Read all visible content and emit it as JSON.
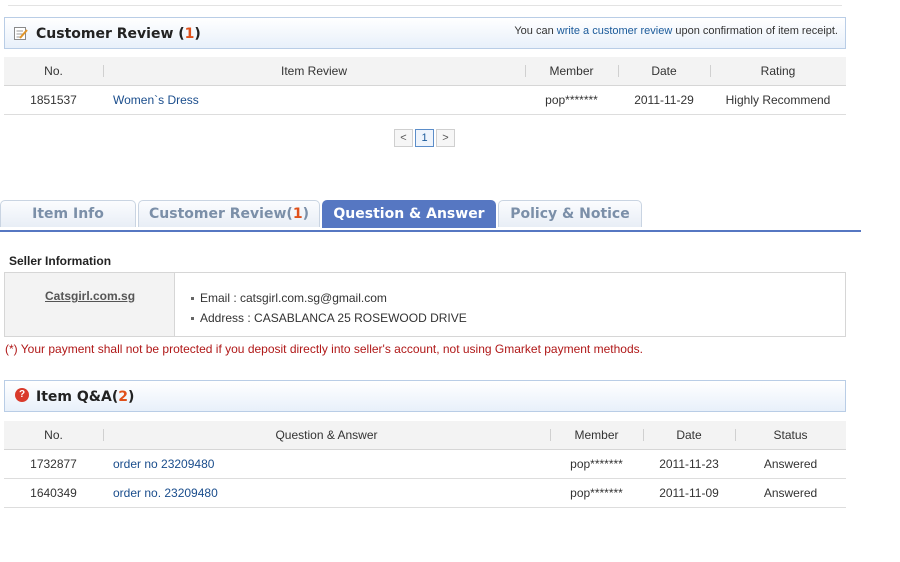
{
  "review": {
    "title": "Customer Review",
    "count": "1",
    "note_prefix": "You can ",
    "note_link": "write a customer review",
    "note_suffix": " upon confirmation of item receipt.",
    "columns": [
      "No.",
      "Item Review",
      "Member",
      "Date",
      "Rating"
    ],
    "rows": [
      {
        "no": "1851537",
        "item": "Women`s Dress",
        "member": "pop*******",
        "date": "2011-11-29",
        "rating": "Highly Recommend"
      }
    ]
  },
  "pager": {
    "prev": "<",
    "current": "1",
    "next": ">"
  },
  "tabs": [
    {
      "label": "Item Info",
      "count": ""
    },
    {
      "label": "Customer Review",
      "count": "1"
    },
    {
      "label": "Question & Answer",
      "count": ""
    },
    {
      "label": "Policy & Notice",
      "count": ""
    }
  ],
  "seller": {
    "heading": "Seller Information",
    "name": "Catsgirl.com.sg",
    "email": "Email : catsgirl.com.sg@gmail.com",
    "address": "Address : CASABLANCA 25 ROSEWOOD DRIVE",
    "warning": "(*) Your payment shall not be protected if you deposit directly into seller's account, not using Gmarket payment methods."
  },
  "qa": {
    "title": "Item Q&A",
    "count": "2",
    "icon": "question-icon",
    "columns": [
      "No.",
      "Question & Answer",
      "Member",
      "Date",
      "Status"
    ],
    "rows": [
      {
        "no": "1732877",
        "question": "order no 23209480",
        "member": "pop*******",
        "date": "2011-11-23",
        "status": "Answered"
      },
      {
        "no": "1640349",
        "question": "order no. 23209480",
        "member": "pop*******",
        "date": "2011-11-09",
        "status": "Answered"
      }
    ]
  },
  "colors": {
    "accent": "#5677c2",
    "count": "#e0501a",
    "link": "#1a4d8c",
    "rating": "#c8761b",
    "warning": "#b01818"
  }
}
